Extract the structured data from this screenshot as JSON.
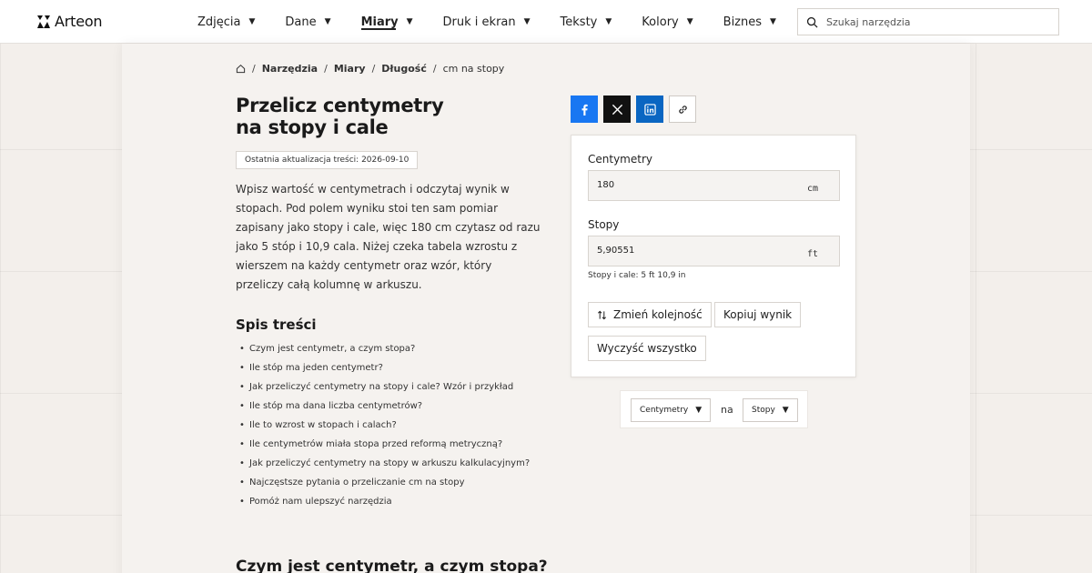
{
  "brand": {
    "name": "Arteon"
  },
  "nav": [
    {
      "label": "Zdjęcia",
      "active": false
    },
    {
      "label": "Dane",
      "active": false
    },
    {
      "label": "Miary",
      "active": true
    },
    {
      "label": "Druk i ekran",
      "active": false
    },
    {
      "label": "Teksty",
      "active": false
    },
    {
      "label": "Kolory",
      "active": false
    },
    {
      "label": "Biznes",
      "active": false
    }
  ],
  "search": {
    "placeholder": "Szukaj narzędzia"
  },
  "breadcrumb": {
    "items": [
      "Narzędzia",
      "Miary",
      "Długość",
      "cm na stopy"
    ]
  },
  "page": {
    "title_line1": "Przelicz centymetry",
    "title_line2": "na stopy i cale",
    "updated": "Ostatnia aktualizacja treści: 2026-09-10",
    "intro": "Wpisz wartość w centymetrach i odczytaj wynik w stopach. Pod polem wyniku stoi ten sam pomiar zapisany jako stopy i cale, więc 180 cm czytasz od razu jako 5 stóp i 10,9 cala. Niżej czeka tabela wzrostu z wierszem na każdy centymetr oraz wzór, który przeliczy całą kolumnę w arkuszu."
  },
  "toc": {
    "title": "Spis treści",
    "items": [
      "Czym jest centymetr, a czym stopa?",
      "Ile stóp ma jeden centymetr?",
      "Jak przeliczyć centymetry na stopy i cale? Wzór i przykład",
      "Ile stóp ma dana liczba centymetrów?",
      "Ile to wzrost w stopach i calach?",
      "Ile centymetrów miała stopa przed reformą metryczną?",
      "Jak przeliczyć centymetry na stopy w arkuszu kalkulacyjnym?",
      "Najczęstsze pytania o przeliczanie cm na stopy",
      "Pomóż nam ulepszyć narzędzia"
    ]
  },
  "section_heading": "Czym jest centymetr, a czym stopa?",
  "share": {
    "icons": [
      "facebook-icon",
      "x-icon",
      "linkedin-icon",
      "link-icon"
    ],
    "colors": {
      "facebook": "#1877f2",
      "x": "#111111",
      "linkedin": "#0a66c2"
    }
  },
  "converter": {
    "from_label": "Centymetry",
    "from_value": "180",
    "from_unit": "cm",
    "to_label": "Stopy",
    "to_value": "5,90551",
    "to_unit": "ft",
    "feet_inches": "Stopy i cale: 5 ft 10,9 in",
    "swap_label": "Zmień kolejność",
    "copy_label": "Kopiuj wynik",
    "clear_label": "Wyczyść wszystko"
  },
  "unit_selector": {
    "from": "Centymetry",
    "joiner": "na",
    "to": "Stopy"
  }
}
